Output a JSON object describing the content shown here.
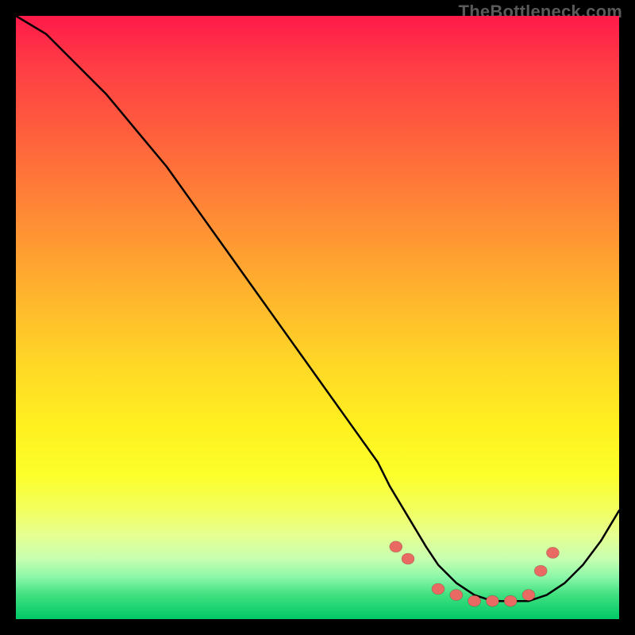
{
  "watermark": "TheBottleneck.com",
  "chart_data": {
    "type": "line",
    "title": "",
    "xlabel": "",
    "ylabel": "",
    "xlim": [
      0,
      100
    ],
    "ylim": [
      0,
      100
    ],
    "series": [
      {
        "name": "curve",
        "x": [
          0,
          5,
          10,
          15,
          20,
          25,
          30,
          35,
          40,
          45,
          50,
          55,
          60,
          62,
          65,
          68,
          70,
          73,
          76,
          79,
          82,
          85,
          88,
          91,
          94,
          97,
          100
        ],
        "y": [
          100,
          97,
          92,
          87,
          81,
          75,
          68,
          61,
          54,
          47,
          40,
          33,
          26,
          22,
          17,
          12,
          9,
          6,
          4,
          3,
          3,
          3,
          4,
          6,
          9,
          13,
          18
        ]
      }
    ],
    "markers": {
      "name": "dots",
      "x": [
        63,
        65,
        70,
        73,
        76,
        79,
        82,
        85,
        87,
        89
      ],
      "y": [
        12,
        10,
        5,
        4,
        3,
        3,
        3,
        4,
        8,
        11
      ]
    },
    "gradient": {
      "top_color": "#ff1a4a",
      "mid_color": "#fff020",
      "bottom_color": "#00c866"
    }
  }
}
